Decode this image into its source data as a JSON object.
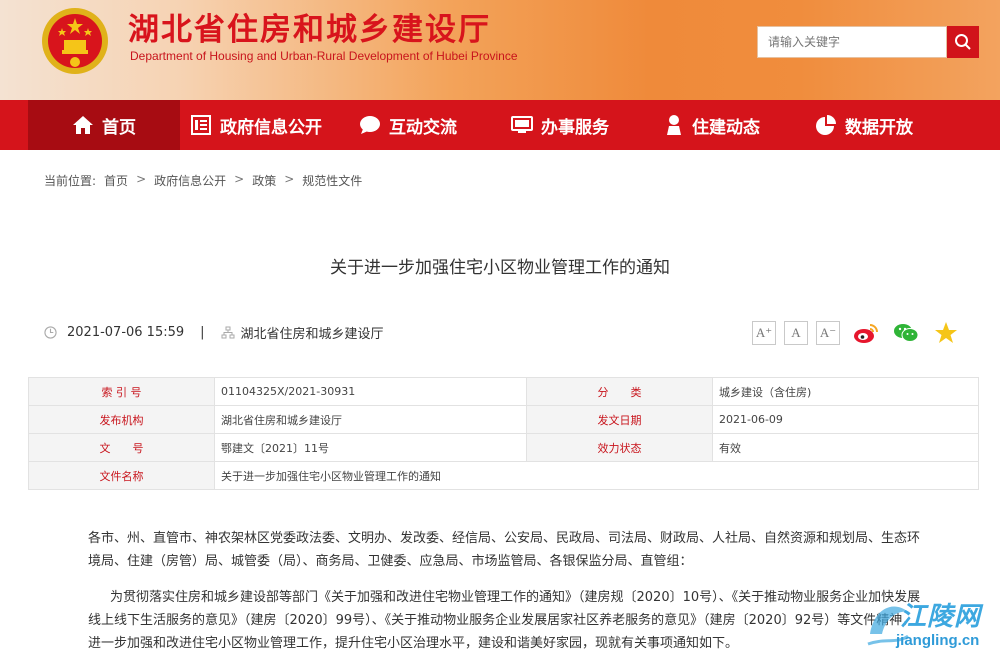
{
  "header": {
    "title": "湖北省住房和城乡建设厅",
    "subtitle": "Department of Housing and Urban-Rural Development of Hubei Province",
    "search_placeholder": "请输入关键字"
  },
  "nav": [
    {
      "label": "首页",
      "icon": "home-icon",
      "active": true
    },
    {
      "label": "政府信息公开",
      "icon": "document-list-icon",
      "active": false
    },
    {
      "label": "互动交流",
      "icon": "chat-bubble-icon",
      "active": false
    },
    {
      "label": "办事服务",
      "icon": "monitor-icon",
      "active": false
    },
    {
      "label": "住建动态",
      "icon": "person-icon",
      "active": false
    },
    {
      "label": "数据开放",
      "icon": "pie-chart-icon",
      "active": false
    }
  ],
  "breadcrumb": {
    "prefix": "当前位置:",
    "items": [
      "首页",
      "政府信息公开",
      "政策",
      "规范性文件"
    ],
    "separator": ">"
  },
  "article": {
    "title": "关于进一步加强住宅小区物业管理工作的通知",
    "date": "2021-07-06 15:59",
    "divider": "|",
    "source": "湖北省住房和城乡建设厅",
    "font_sizes": [
      "A⁺",
      "A",
      "A⁻"
    ],
    "share": [
      "weibo-icon",
      "wechat-icon",
      "favorite-star-icon"
    ]
  },
  "info_table": {
    "rows": [
      {
        "k1": "索 引 号",
        "v1": "01104325X/2021-30931",
        "k2": "分　　类",
        "v2": "城乡建设（含住房)"
      },
      {
        "k1": "发布机构",
        "v1": "湖北省住房和城乡建设厅",
        "k2": "发文日期",
        "v2": "2021-06-09"
      },
      {
        "k1": "文　　号",
        "v1": "鄂建文〔2021〕11号",
        "k2": "效力状态",
        "v2": "有效"
      }
    ],
    "last_row": {
      "k": "文件名称",
      "v": "关于进一步加强住宅小区物业管理工作的通知"
    }
  },
  "body": {
    "p1": "各市、州、直管市、神农架林区党委政法委、文明办、发改委、经信局、公安局、民政局、司法局、财政局、人社局、自然资源和规划局、生态环境局、住建（房管）局、城管委（局）、商务局、卫健委、应急局、市场监管局、各银保监分局、直管组：",
    "p2": "为贯彻落实住房和城乡建设部等部门《关于加强和改进住宅物业管理工作的通知》（建房规〔2020〕10号）、《关于推动物业服务企业加快发展线上线下生活服务的意见》（建房〔2020〕99号）、《关于推动物业服务企业发展居家社区养老服务的意见》（建房〔2020〕92号）等文件精神，进一步加强和改进住宅小区物业管理工作，提升住宅小区治理水平，建设和谐美好家园，现就有关事项通知如下。"
  },
  "watermark": {
    "text": "江陵网",
    "sub": "jiangling.cn"
  },
  "colors": {
    "brand_red": "#d5141b",
    "active_nav": "#a70c12",
    "label_red": "#c8141c",
    "watermark_blue": "#3da8e0"
  }
}
